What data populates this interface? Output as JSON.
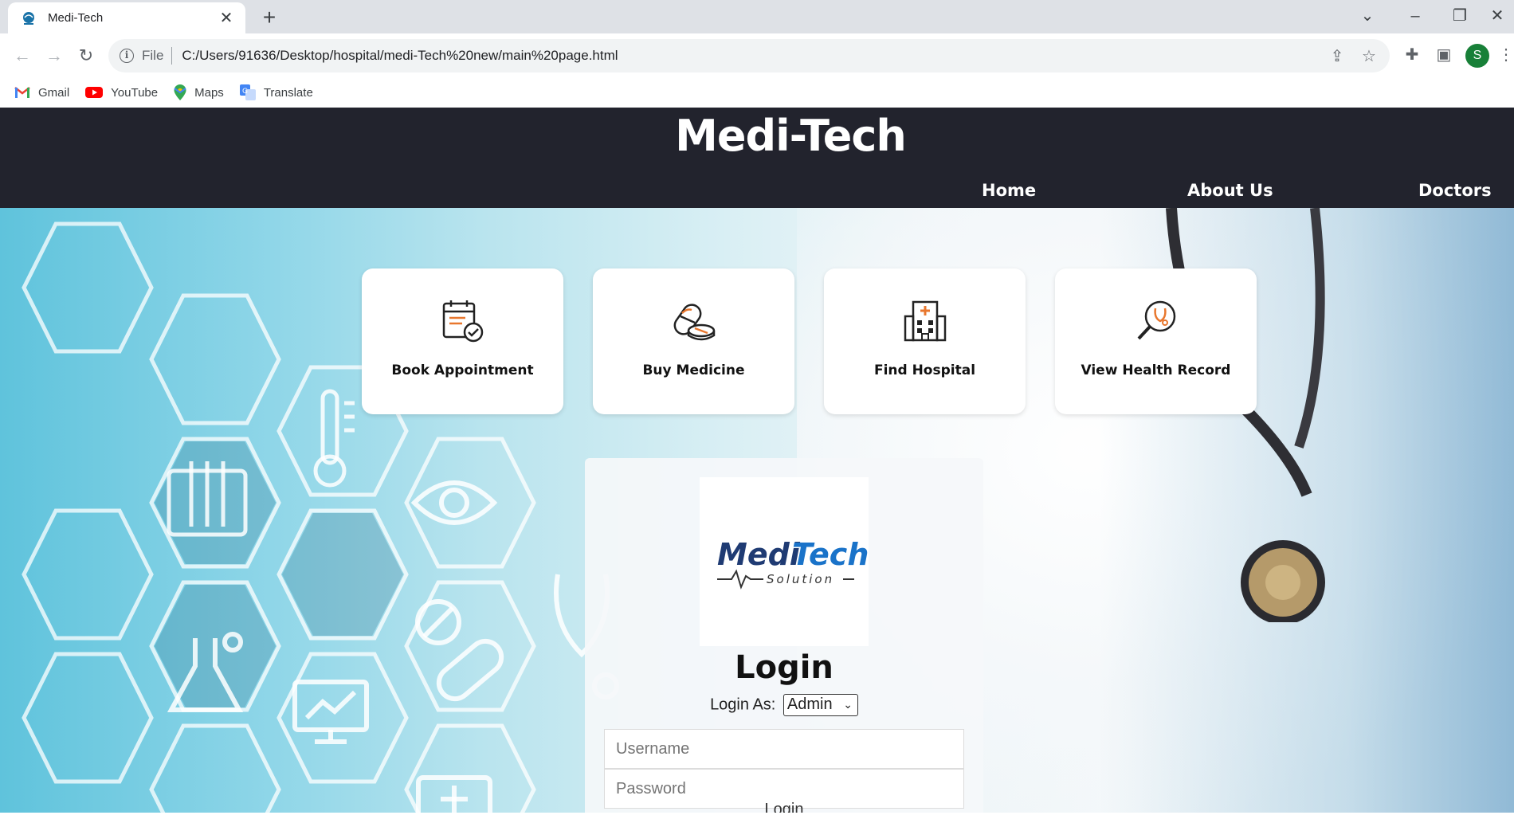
{
  "browser": {
    "tab_title": "Medi-Tech",
    "file_label": "File",
    "url": "C:/Users/91636/Desktop/hospital/medi-Tech%20new/main%20page.html",
    "avatar_letter": "S",
    "bookmarks": [
      {
        "label": "Gmail",
        "icon": "gmail-icon"
      },
      {
        "label": "YouTube",
        "icon": "youtube-icon"
      },
      {
        "label": "Maps",
        "icon": "maps-icon"
      },
      {
        "label": "Translate",
        "icon": "translate-icon"
      }
    ]
  },
  "site": {
    "title": "Medi-Tech",
    "nav": {
      "home": "Home",
      "about": "About Us",
      "doctors": "Doctors"
    },
    "header_color": "#22232d"
  },
  "services": [
    {
      "label": "Book Appointment",
      "icon": "calendar-check-icon"
    },
    {
      "label": "Buy Medicine",
      "icon": "pills-icon"
    },
    {
      "label": "Find Hospital",
      "icon": "hospital-icon"
    },
    {
      "label": "View Health Record",
      "icon": "magnifier-stethoscope-icon"
    }
  ],
  "login": {
    "logo_word_1": "Medi",
    "logo_word_2": "Tech",
    "logo_sub": "Solution",
    "title": "Login",
    "login_as_label": "Login As:",
    "role_selected": "Admin",
    "username_placeholder": "Username",
    "password_placeholder": "Password",
    "submit_label": "Login"
  }
}
